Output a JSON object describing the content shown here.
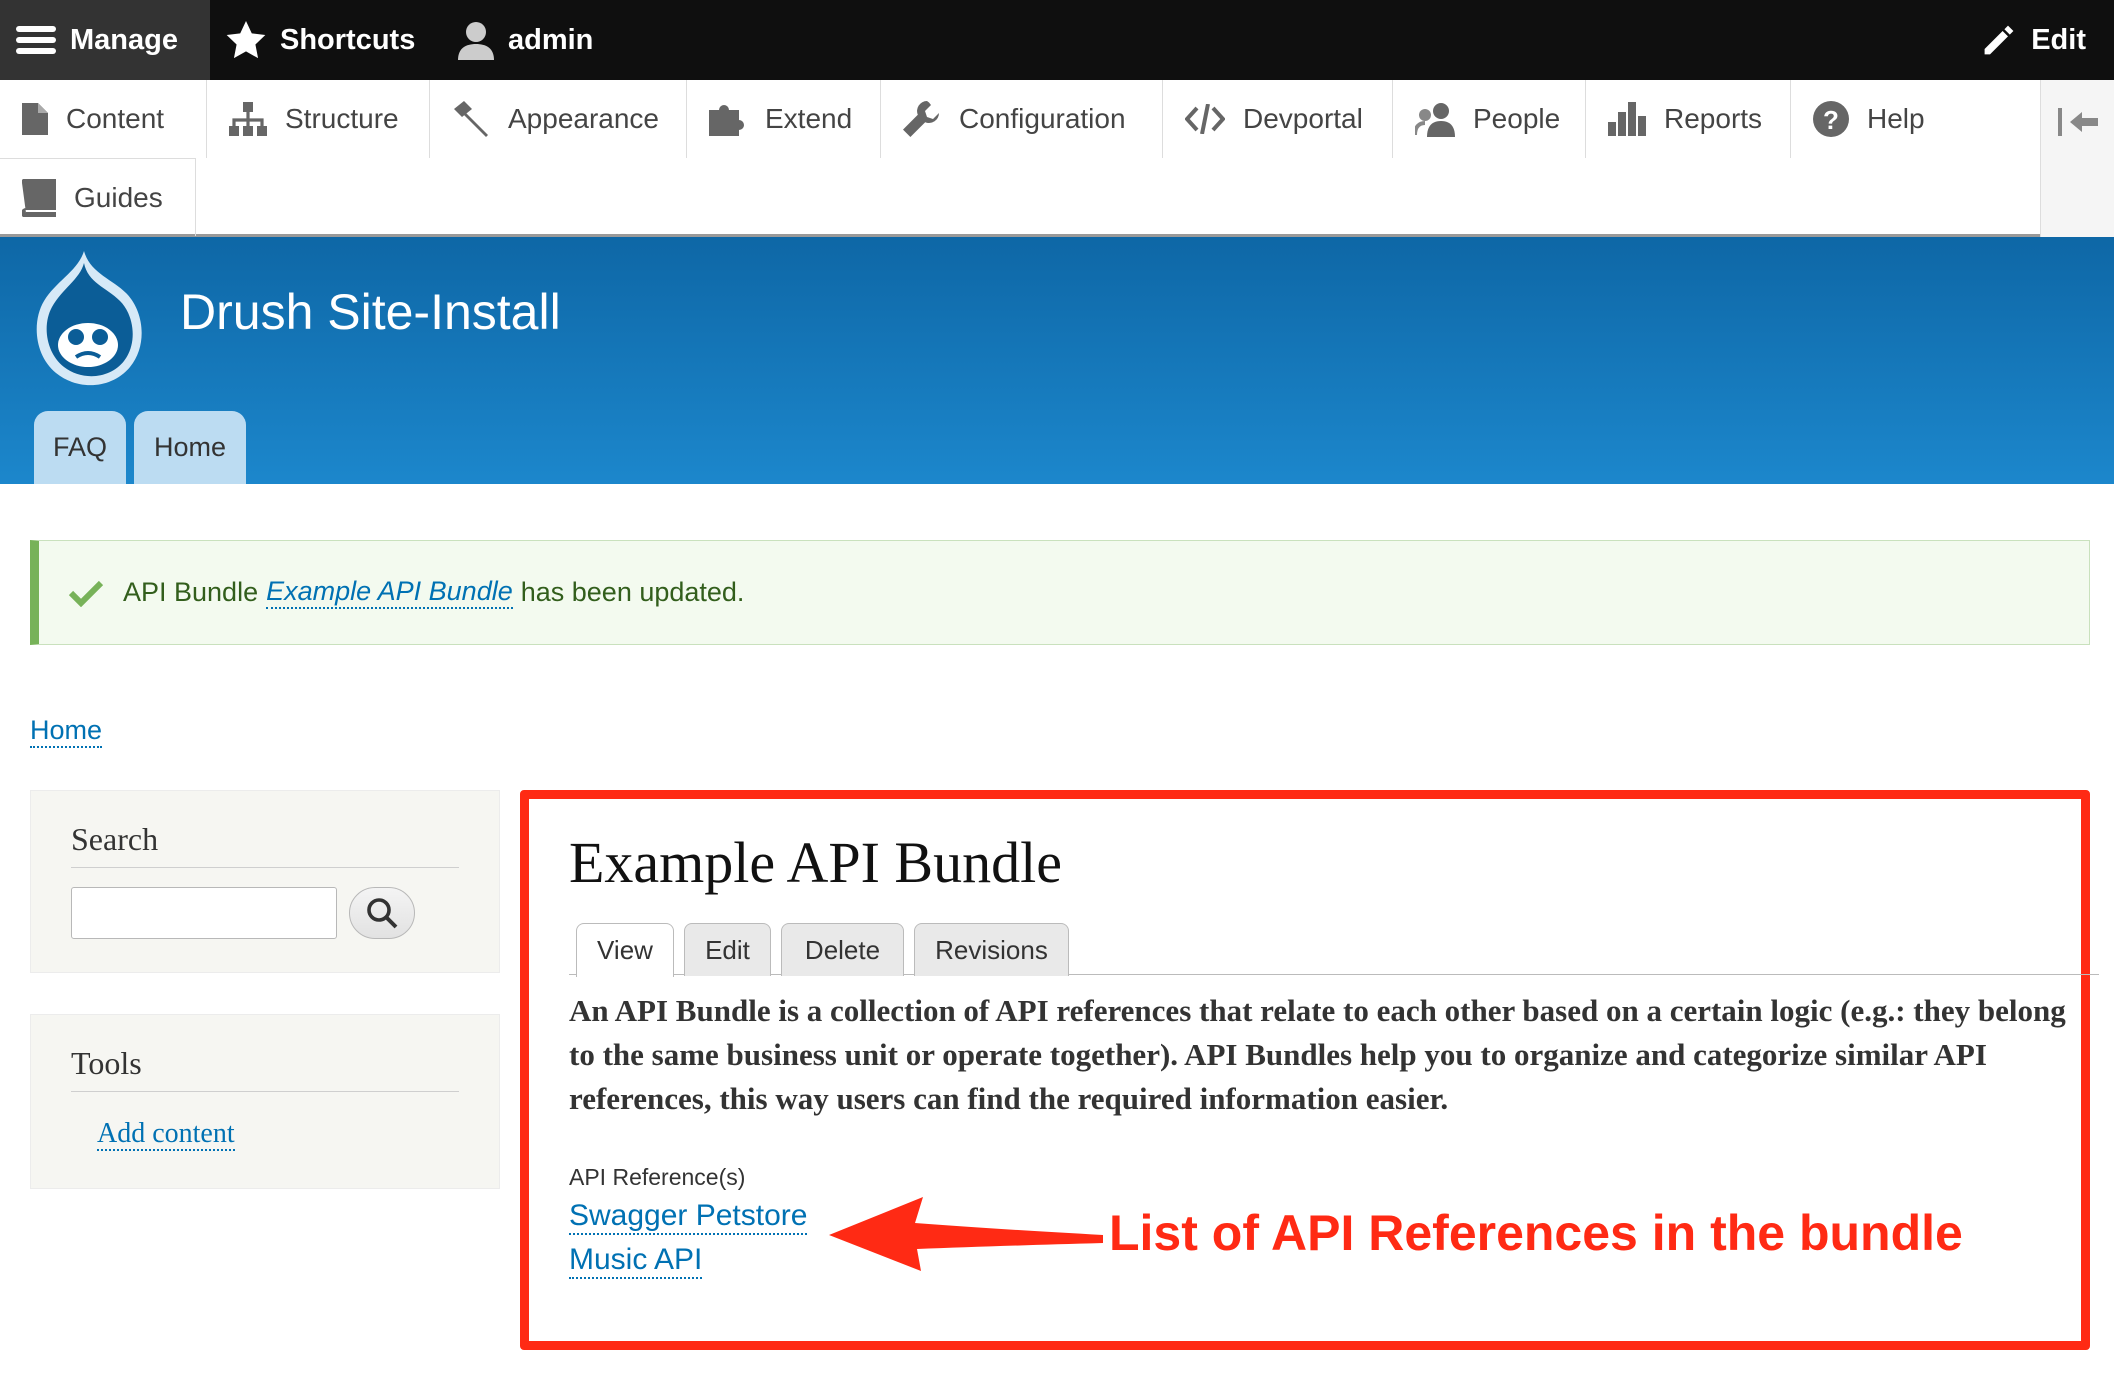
{
  "toolbar": {
    "manage_label": "Manage",
    "shortcuts_label": "Shortcuts",
    "user_label": "admin",
    "edit_label": "Edit"
  },
  "admin_menu": {
    "items": [
      {
        "label": "Content",
        "icon": "file-icon"
      },
      {
        "label": "Structure",
        "icon": "sitemap-icon"
      },
      {
        "label": "Appearance",
        "icon": "paintbrush-icon"
      },
      {
        "label": "Extend",
        "icon": "puzzle-icon"
      },
      {
        "label": "Configuration",
        "icon": "wrench-icon"
      },
      {
        "label": "Devportal",
        "icon": "code-icon"
      },
      {
        "label": "People",
        "icon": "people-icon"
      },
      {
        "label": "Reports",
        "icon": "bar-chart-icon"
      },
      {
        "label": "Help",
        "icon": "help-icon"
      },
      {
        "label": "Guides",
        "icon": "book-icon"
      }
    ]
  },
  "header": {
    "site_name": "Drush Site-Install",
    "tabs": [
      {
        "label": "FAQ"
      },
      {
        "label": "Home"
      }
    ]
  },
  "status": {
    "prefix": "API Bundle",
    "link": "Example API Bundle",
    "suffix": "has been updated."
  },
  "breadcrumb": {
    "home": "Home"
  },
  "sidebar": {
    "search": {
      "title": "Search",
      "input_value": ""
    },
    "tools": {
      "title": "Tools",
      "link": "Add content"
    }
  },
  "main": {
    "title": "Example API Bundle",
    "tabs": [
      {
        "label": "View"
      },
      {
        "label": "Edit"
      },
      {
        "label": "Delete"
      },
      {
        "label": "Revisions"
      }
    ],
    "body": "An API Bundle is a collection of API references that relate to each other based on a certain logic (e.g.: they belong to the same business unit or operate together). API Bundles help you to organize and categorize similar API references, this way users can find the required information easier.",
    "field_label": "API Reference(s)",
    "references": [
      "Swagger Petstore",
      "Music API"
    ],
    "annotation": "List of API References in the bundle"
  },
  "colors": {
    "header_blue": "#1a7dc3",
    "annotation_red": "#ff2a14",
    "link_blue": "#0071b3",
    "status_green": "#77b259"
  }
}
